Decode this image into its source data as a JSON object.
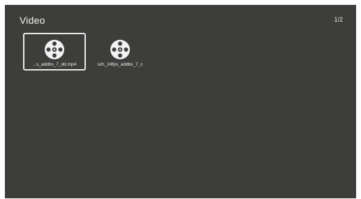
{
  "header": {
    "title": "Video",
    "page_indicator": "1/2"
  },
  "files": [
    {
      "name": "...s_addbs_7_dd.mp4",
      "icon": "film-reel-icon",
      "selected": true
    },
    {
      "name": "sch_24fps_addbs_7_c",
      "icon": "film-reel-icon",
      "selected": false
    }
  ],
  "colors": {
    "background": "#3d3d3b",
    "text": "#f2f2f2",
    "selection_border": "#e9e9e9"
  }
}
